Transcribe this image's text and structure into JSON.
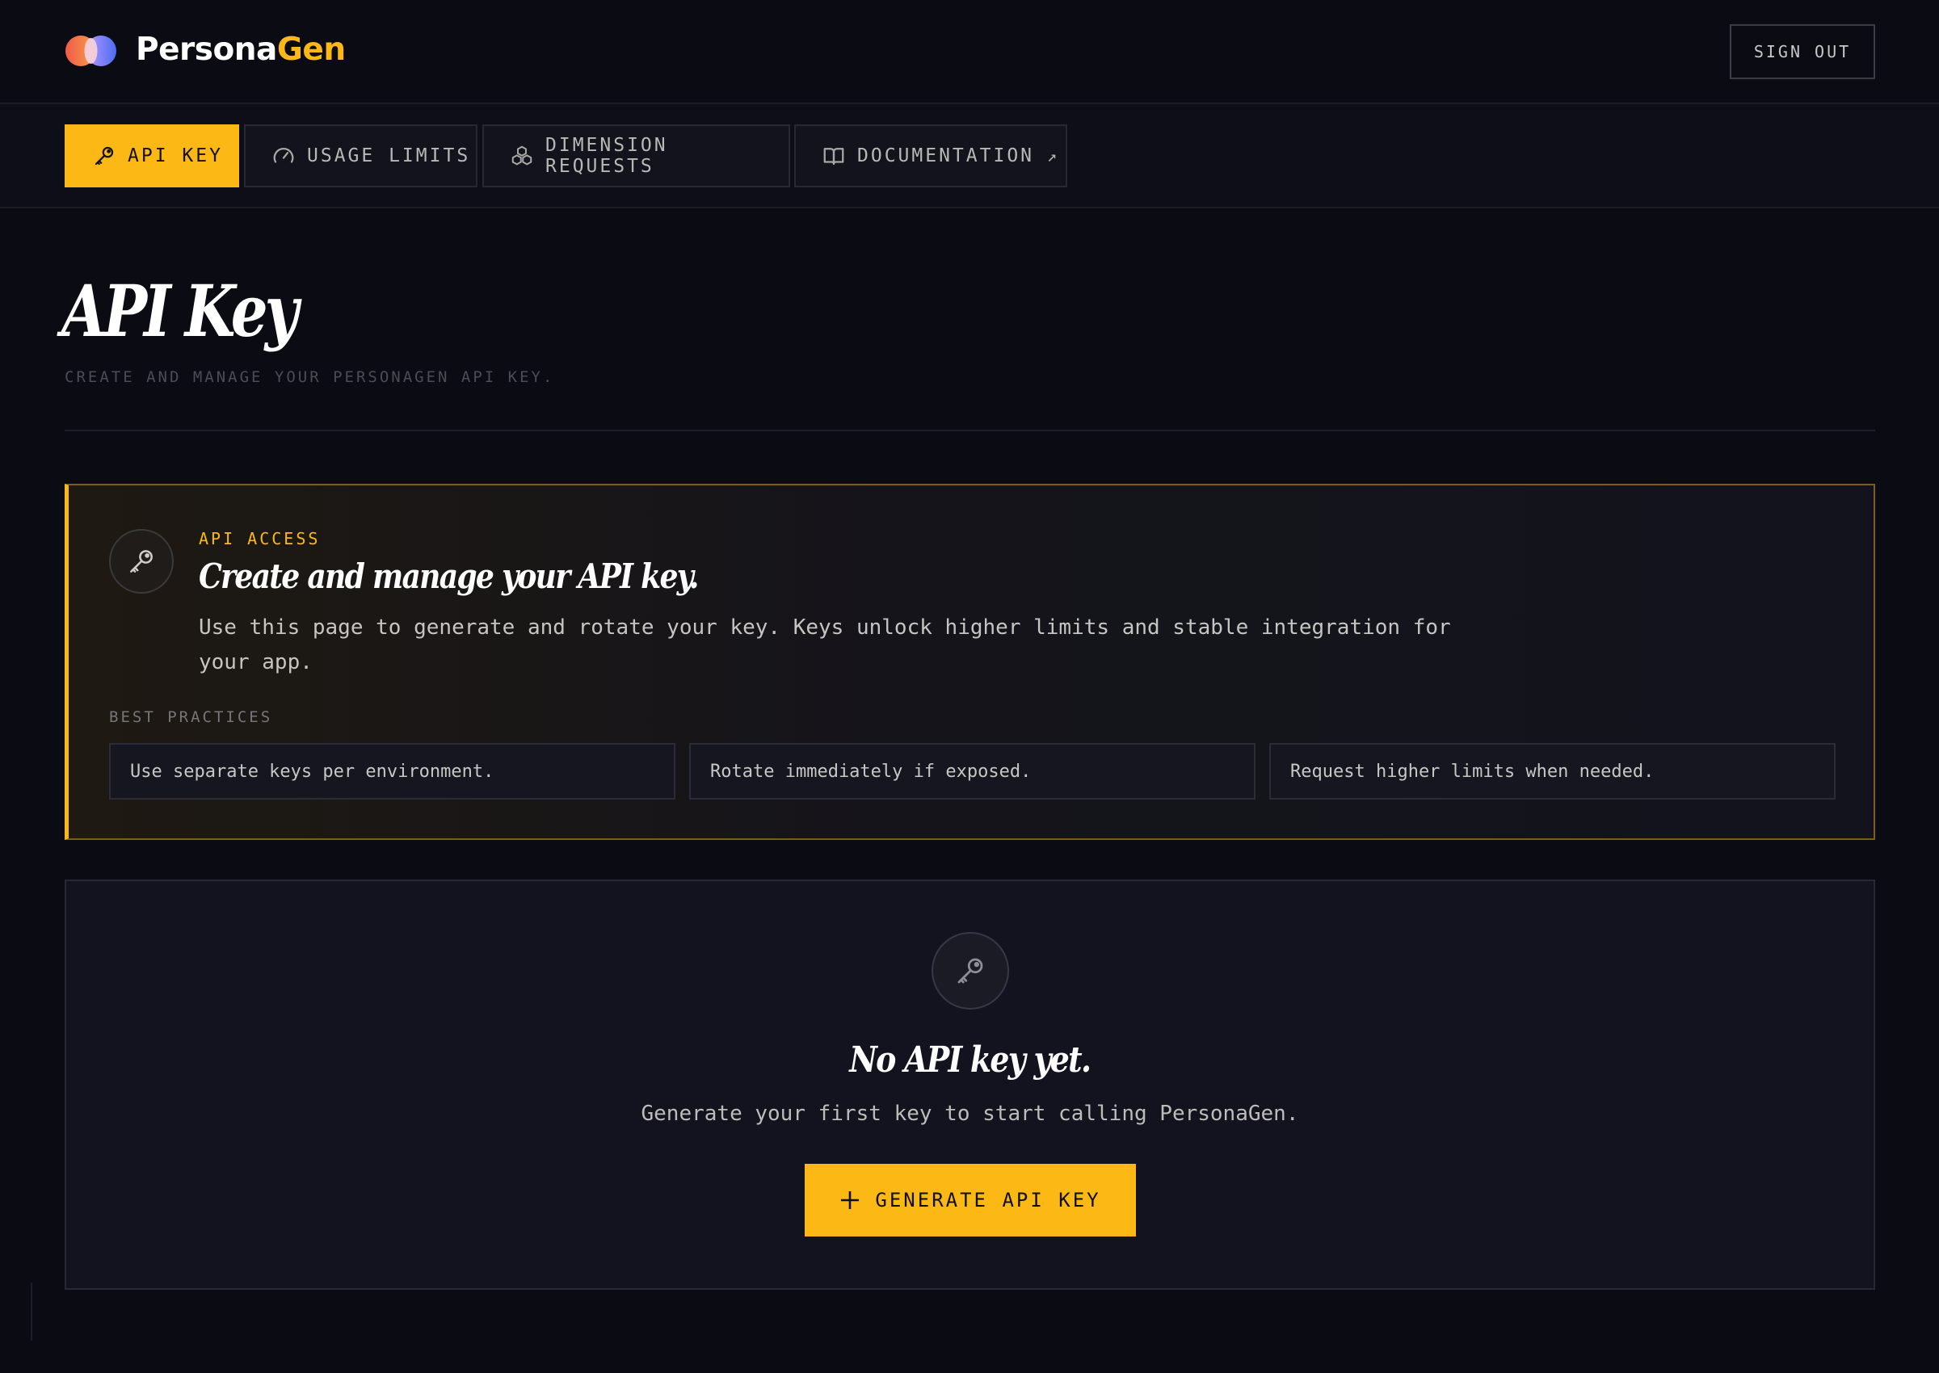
{
  "brand": {
    "name_part1": "Persona",
    "name_part2": "Gen",
    "accent_color": "#fcb814"
  },
  "header": {
    "sign_out_label": "SIGN OUT"
  },
  "nav": {
    "tabs": [
      {
        "label": "API KEY",
        "icon": "key-icon",
        "active": true
      },
      {
        "label": "USAGE LIMITS",
        "icon": "gauge-icon",
        "active": false
      },
      {
        "label": "DIMENSION REQUESTS",
        "icon": "cubes-icon",
        "active": false
      },
      {
        "label": "DOCUMENTATION",
        "icon": "book-icon",
        "active": false,
        "external_icon": "↗"
      }
    ]
  },
  "page": {
    "title": "API Key",
    "subtitle": "CREATE AND MANAGE YOUR PERSONAGEN API KEY."
  },
  "info": {
    "eyebrow": "API ACCESS",
    "heading": "Create and manage your API key.",
    "body": "Use this page to generate and rotate your key. Keys unlock higher limits and stable integration for your app.",
    "best_practices_label": "BEST PRACTICES",
    "best_practices": [
      "Use separate keys per environment.",
      "Rotate immediately if exposed.",
      "Request higher limits when needed."
    ]
  },
  "empty_state": {
    "title": "No API key yet.",
    "description": "Generate your first key to start calling PersonaGen.",
    "button_label": "GENERATE API KEY",
    "button_icon": "plus-icon"
  }
}
